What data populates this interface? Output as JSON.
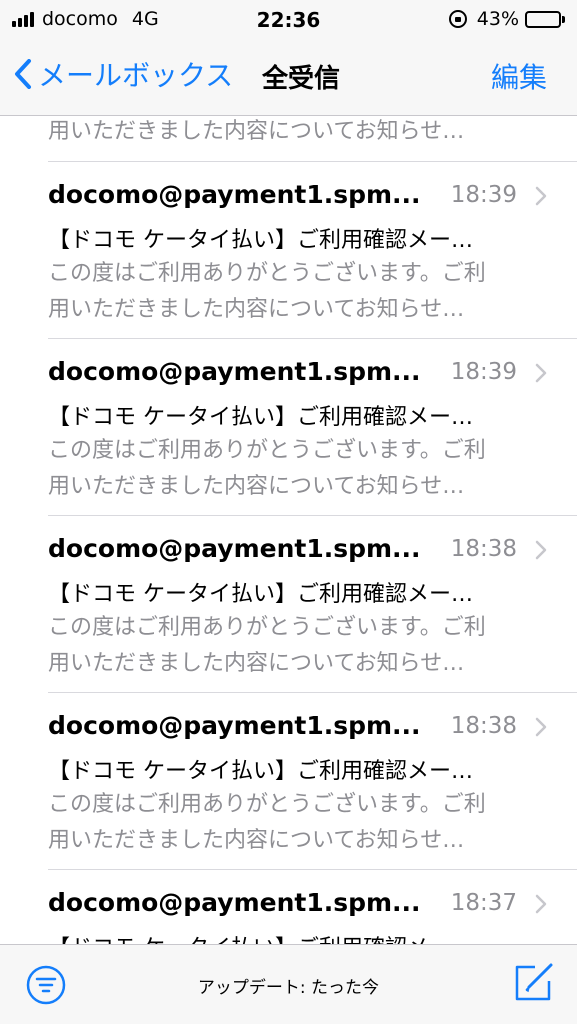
{
  "status_bar": {
    "carrier": "docomo",
    "network": "4G",
    "time": "22:36",
    "battery": "43%",
    "battery_level": 0.43
  },
  "nav": {
    "back_label": "メールボックス",
    "title": "全受信",
    "edit_label": "編集"
  },
  "messages": [
    {
      "sender": "",
      "time": "",
      "subject": "",
      "preview_line1": "",
      "preview_line2": "用いただきました内容についてお知らせ…"
    },
    {
      "sender": "docomo@payment1.spm...",
      "time": "18:39",
      "subject": "【ドコモ ケータイ払い】ご利用確認メー…",
      "preview_line1": "この度はご利用ありがとうございます。ご利",
      "preview_line2": "用いただきました内容についてお知らせ…"
    },
    {
      "sender": "docomo@payment1.spm...",
      "time": "18:39",
      "subject": "【ドコモ ケータイ払い】ご利用確認メー…",
      "preview_line1": "この度はご利用ありがとうございます。ご利",
      "preview_line2": "用いただきました内容についてお知らせ…"
    },
    {
      "sender": "docomo@payment1.spm...",
      "time": "18:38",
      "subject": "【ドコモ ケータイ払い】ご利用確認メー…",
      "preview_line1": "この度はご利用ありがとうございます。ご利",
      "preview_line2": "用いただきました内容についてお知らせ…"
    },
    {
      "sender": "docomo@payment1.spm...",
      "time": "18:38",
      "subject": "【ドコモ ケータイ払い】ご利用確認メー…",
      "preview_line1": "この度はご利用ありがとうございます。ご利",
      "preview_line2": "用いただきました内容についてお知らせ…"
    },
    {
      "sender": "docomo@payment1.spm...",
      "time": "18:37",
      "subject": "【ドコモ ケータイ払い】ご利用確認メー…",
      "preview_line1": "",
      "preview_line2": ""
    }
  ],
  "toolbar": {
    "update_text": "アップデート: たった今"
  },
  "colors": {
    "accent": "#147efb",
    "secondary_text": "#8e8e93",
    "bar_background": "#f7f7f7"
  },
  "icons": {
    "back": "chevron-left-icon",
    "disclosure": "chevron-right-icon",
    "filter": "filter-icon",
    "compose": "compose-icon",
    "orientation_lock": "orientation-lock-icon",
    "battery": "battery-icon",
    "signal": "signal-bars-icon"
  }
}
